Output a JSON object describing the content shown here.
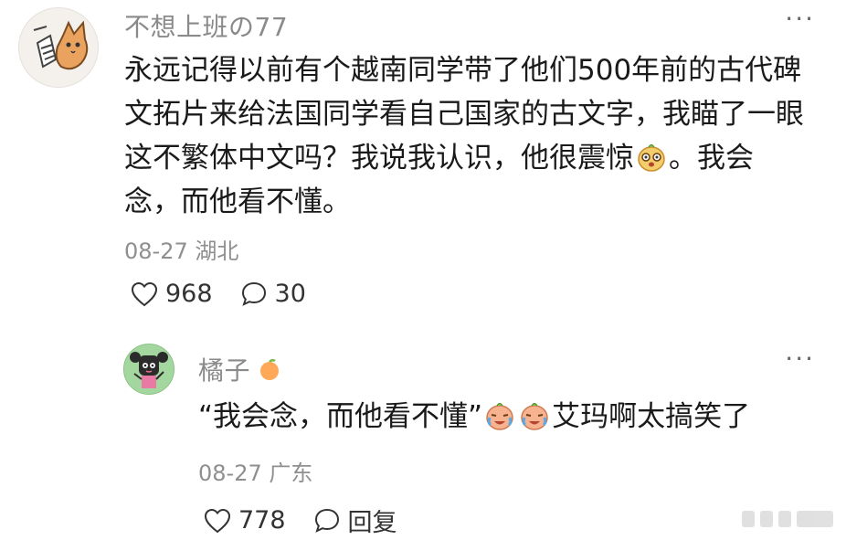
{
  "comments": [
    {
      "username": "不想上班の77",
      "avatar_icon": "cartoon-cat-avatar-icon",
      "more_label": "···",
      "text_lines": [
        "永远记得以前有个越南同学带了他们500年前的古代碑",
        "文拓片来给法国同学看自己国家的古文字，我瞄了一眼",
        "这不繁体中文吗？我说我认识，他很震惊",
        "。我会",
        "念，而他看不懂。"
      ],
      "emoji": "shocked-face-emoji",
      "date": "08-27",
      "location": "湖北",
      "likes": "968",
      "replies": "30"
    },
    {
      "username": "橘子",
      "badge_icon": "orange-icon",
      "avatar_icon": "cartoon-girl-avatar-icon",
      "more_label": "···",
      "text_main": "“我会念，而他看不懂”",
      "text_tail": "艾玛啊太搞笑了",
      "emoji": "laughing-crying-emoji",
      "date": "08-27",
      "location": "广东",
      "likes": "778",
      "reply_label": "回复"
    }
  ]
}
